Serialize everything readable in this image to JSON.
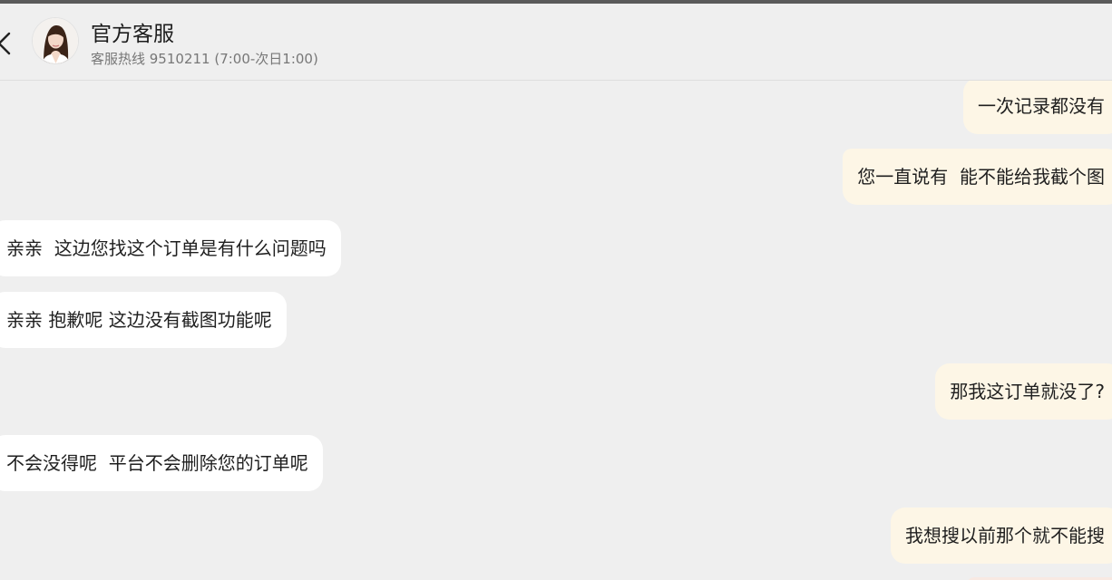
{
  "header": {
    "title": "官方客服",
    "subtitle": "客服热线 9510211 (7:00-次日1:00)"
  },
  "messages": [
    {
      "side": "right",
      "text": "一次记录都没有"
    },
    {
      "side": "right",
      "text": "您一直说有  能不能给我截个图"
    },
    {
      "side": "left",
      "text": "亲亲  这边您找这个订单是有什么问题吗"
    },
    {
      "side": "left",
      "text": "亲亲 抱歉呢 这边没有截图功能呢"
    },
    {
      "side": "right",
      "text": "那我这订单就没了?"
    },
    {
      "side": "left",
      "text": "不会没得呢  平台不会删除您的订单呢"
    },
    {
      "side": "right",
      "text": "我想搜以前那个就不能搜"
    }
  ],
  "colors": {
    "background": "#efefef",
    "incoming_bubble": "#ffffff",
    "outgoing_bubble": "#fdf6e6"
  },
  "icons": {
    "back": "chevron-left-icon",
    "avatar": "agent-avatar"
  }
}
